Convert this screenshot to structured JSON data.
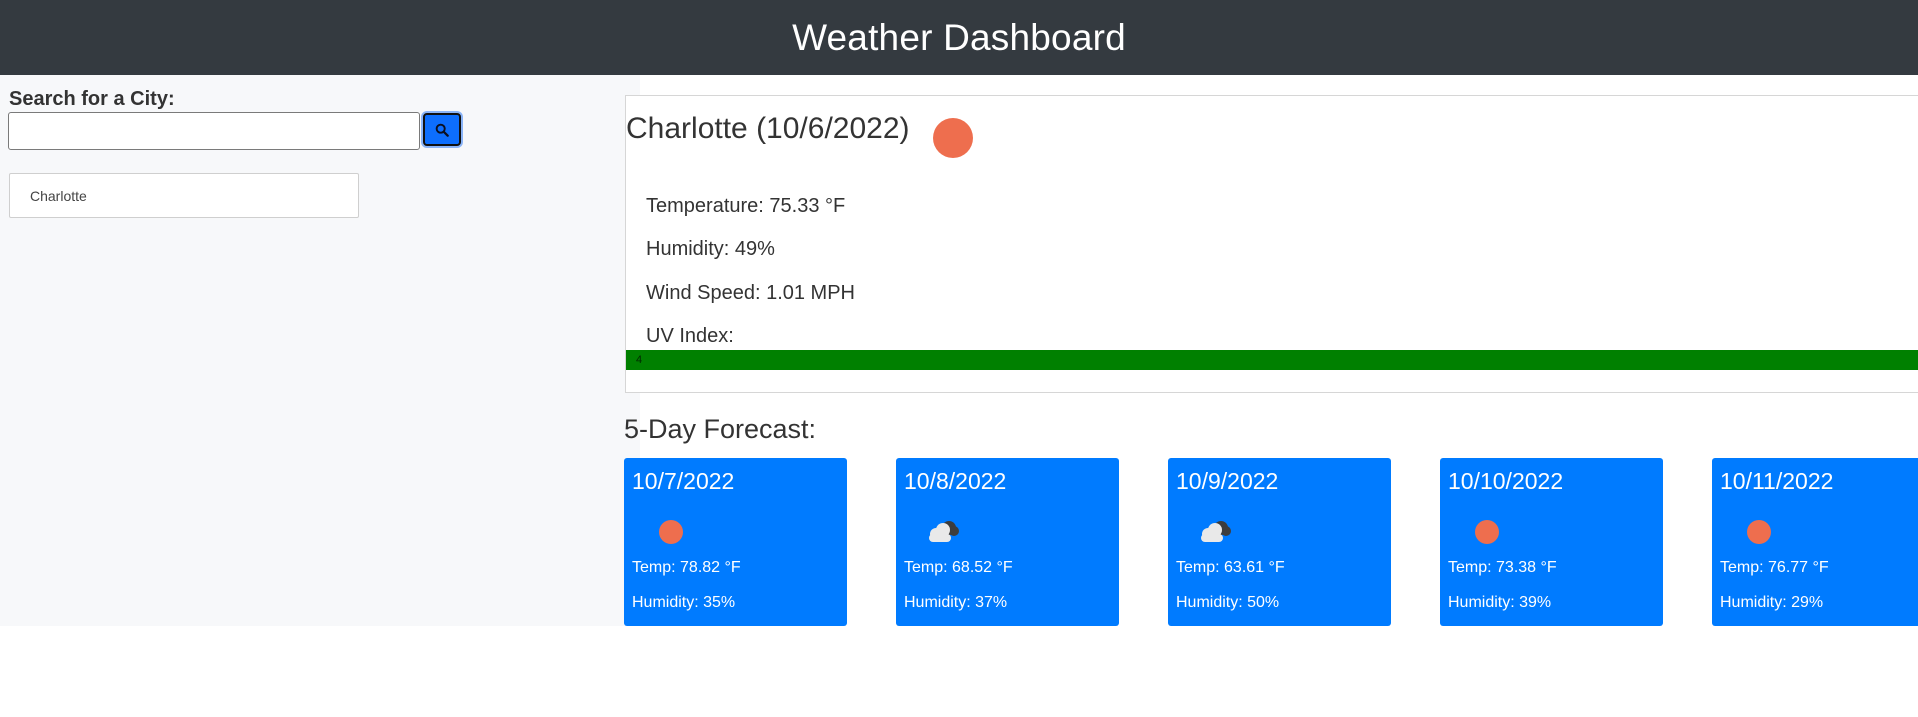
{
  "header": {
    "title": "Weather Dashboard"
  },
  "search": {
    "label": "Search for a City:",
    "value": "",
    "placeholder": ""
  },
  "history": [
    "Charlotte"
  ],
  "current": {
    "title": "Charlotte (10/6/2022)",
    "icon": "sun-icon",
    "temperature": "Temperature: 75.33 °F",
    "humidity": "Humidity: 49%",
    "wind": "Wind Speed: 1.01 MPH",
    "uv_label": "UV Index:",
    "uv_value": "4",
    "uv_color": "#008000"
  },
  "forecast": {
    "title": "5-Day Forecast:",
    "days": [
      {
        "date": "10/7/2022",
        "icon": "sun-icon",
        "temp": "Temp: 78.82 °F",
        "humidity": "Humidity: 35%"
      },
      {
        "date": "10/8/2022",
        "icon": "cloud-icon",
        "temp": "Temp: 68.52 °F",
        "humidity": "Humidity: 37%"
      },
      {
        "date": "10/9/2022",
        "icon": "cloud-icon",
        "temp": "Temp: 63.61 °F",
        "humidity": "Humidity: 50%"
      },
      {
        "date": "10/10/2022",
        "icon": "sun-icon",
        "temp": "Temp: 73.38 °F",
        "humidity": "Humidity: 39%"
      },
      {
        "date": "10/11/2022",
        "icon": "sun-icon",
        "temp": "Temp: 76.77 °F",
        "humidity": "Humidity: 29%"
      }
    ]
  },
  "colors": {
    "header_bg": "#343a40",
    "card_bg": "#007bff",
    "sun": "#ee6e4e",
    "search_button": "#0d6efd"
  }
}
